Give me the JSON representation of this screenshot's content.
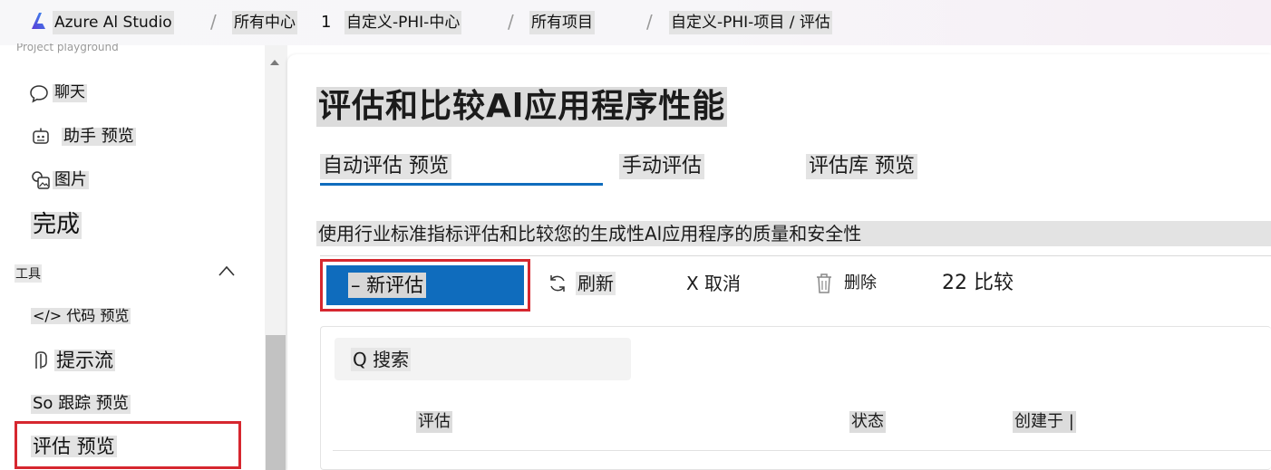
{
  "breadcrumb": {
    "app": "Azure Al Studio",
    "hub_all": "所有中心",
    "hub_index": "1",
    "hub_name": "自定义-PHI-中心",
    "projects_all": "所有项目",
    "project_path": "自定义-PHI-项目 / 评估"
  },
  "sidebar": {
    "cut_label": "Project playground",
    "items": [
      {
        "label": "聊天",
        "icon": "chat-bubble-icon"
      },
      {
        "label": "助手 预览",
        "icon": "bot-icon"
      },
      {
        "label": "图片",
        "icon": "image-icon"
      },
      {
        "label": "完成",
        "icon": ""
      }
    ],
    "tools_section": "工具",
    "tools": [
      {
        "label": "</> 代码 预览"
      },
      {
        "label": "提示流",
        "icon": "prompt-flow-icon"
      },
      {
        "label": "So 跟踪 预览"
      },
      {
        "label": "评估 预览"
      }
    ]
  },
  "main": {
    "title": "评估和比较Al应用程序性能",
    "tabs": [
      "自动评估 预览",
      "手动评估",
      "评估库 预览"
    ],
    "description": "使用行业标准指标评估和比较您的生成性Al应用程序的质量和安全性",
    "toolbar": {
      "new": "– 新评估",
      "refresh": "刷新",
      "cancel": "X 取消",
      "delete": "删除",
      "compare": "22 比较"
    },
    "search_placeholder": "Q 搜索",
    "columns": [
      "评估",
      "状态",
      "创建于 |"
    ]
  },
  "colors": {
    "accent": "#0f6cbd",
    "highlight_border": "#d6272f"
  }
}
